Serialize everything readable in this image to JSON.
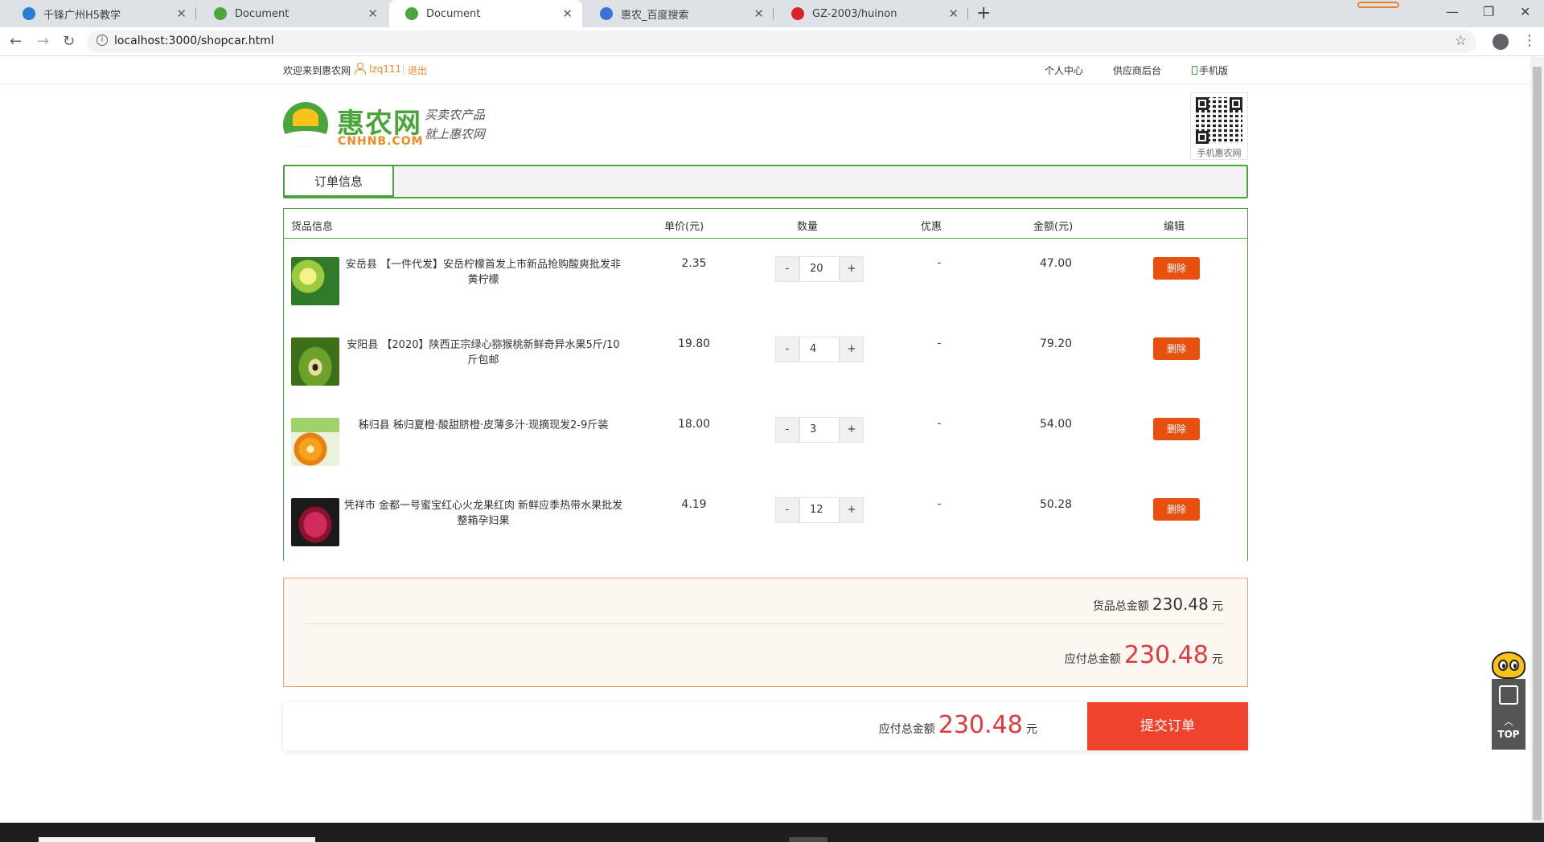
{
  "browser": {
    "tabs": [
      {
        "title": "千锋广州H5教学",
        "favicon_color": "#2a7fd4"
      },
      {
        "title": "Document",
        "favicon_color": "#4aa63a"
      },
      {
        "title": "Document",
        "favicon_color": "#4aa63a"
      },
      {
        "title": "惠农_百度搜索",
        "favicon_color": "#3d6fd8"
      },
      {
        "title": "GZ-2003/huinon",
        "favicon_color": "#d8232a"
      }
    ],
    "active_tab": 2,
    "url": "localhost:3000/shopcar.html"
  },
  "topbar": {
    "welcome": "欢迎来到惠农网",
    "username": "lzq111",
    "logout": "退出",
    "links": [
      "个人中心",
      "供应商后台",
      "手机版"
    ]
  },
  "logo": {
    "name_cn": "惠农网",
    "name_en": "CNHNB.COM",
    "slogan_line1": "买卖农产品",
    "slogan_line2": "就上惠农网"
  },
  "qr": {
    "label": "手机惠农网"
  },
  "order_tab": "订单信息",
  "cart": {
    "headers": {
      "goods": "货品信息",
      "unit_price": "单价(元)",
      "quantity": "数量",
      "discount": "优惠",
      "amount": "金额(元)",
      "edit": "编辑"
    },
    "items": [
      {
        "name": "安岳县 【一件代发】安岳柠檬首发上市新品抢购酸爽批发非黄柠檬",
        "price": "2.35",
        "qty": "20",
        "discount": "-",
        "amount": "47.00",
        "delete": "删除",
        "minus": "-",
        "plus": "+"
      },
      {
        "name": "安阳县 【2020】陕西正宗绿心猕猴桃新鲜奇异水果5斤/10斤包邮",
        "price": "19.80",
        "qty": "4",
        "discount": "-",
        "amount": "79.20",
        "delete": "删除",
        "minus": "-",
        "plus": "+"
      },
      {
        "name": "秭归县 秭归夏橙·酸甜脐橙·皮薄多汁·现摘现发2-9斤装",
        "price": "18.00",
        "qty": "3",
        "discount": "-",
        "amount": "54.00",
        "delete": "删除",
        "minus": "-",
        "plus": "+"
      },
      {
        "name": "凭祥市 金都一号蜜宝红心火龙果红肉 新鲜应季热带水果批发整箱孕妇果",
        "price": "4.19",
        "qty": "12",
        "discount": "-",
        "amount": "50.28",
        "delete": "删除",
        "minus": "-",
        "plus": "+"
      }
    ]
  },
  "summary": {
    "goods_total_label": "货品总金额",
    "goods_total": "230.48",
    "payable_label": "应付总金额",
    "payable": "230.48",
    "unit": "元"
  },
  "bottom": {
    "payable_label": "应付总金额",
    "payable": "230.48",
    "unit": "元",
    "submit": "提交订单"
  },
  "float": {
    "top_label": "TOP"
  },
  "colors": {
    "brand_green": "#4aa63a",
    "accent_orange": "#f08a24",
    "price_red": "#e4393c",
    "submit_red": "#f0432d",
    "delete_orange": "#e8500f"
  }
}
